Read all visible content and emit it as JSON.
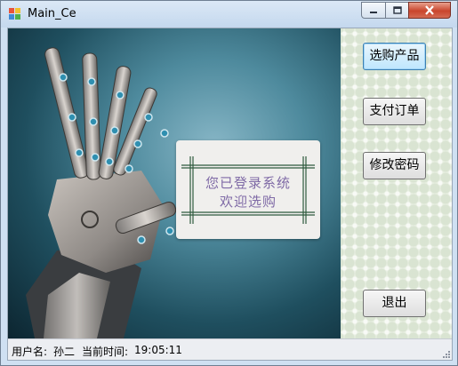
{
  "window": {
    "title": "Main_Ce",
    "icons": [
      "app-icon",
      "minimize-icon",
      "maximize-icon",
      "close-icon"
    ]
  },
  "card": {
    "line1": "您已登录系统",
    "line2": "欢迎选购"
  },
  "buttons": {
    "select_products": "选购产品",
    "pay_order": "支付订单",
    "change_password": "修改密码",
    "exit": "退出"
  },
  "status": {
    "user_label": "用户名:",
    "user_name": "孙二",
    "time_label": "当前时间:",
    "time_value": "19:05:11"
  },
  "colors": {
    "card_text": "#7f6aa6",
    "close_button": "#c9452c",
    "focus_border": "#3c7fb1"
  }
}
